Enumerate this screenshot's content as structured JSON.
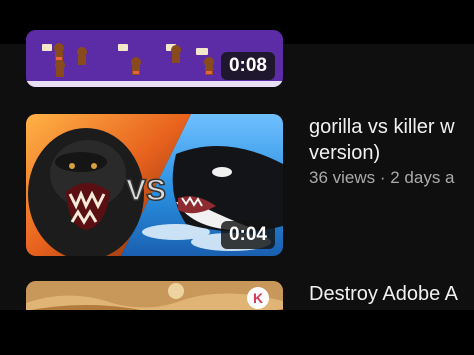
{
  "feed": {
    "videos": [
      {
        "title_line1": "",
        "title_line2": "",
        "meta": "",
        "duration": "0:08"
      },
      {
        "title_line1": "gorilla vs killer w",
        "title_line2": "version)",
        "meta": "36 views · 2 days a",
        "duration": "0:04",
        "thumb_text": "VS"
      },
      {
        "title_line1": "Destroy Adobe A",
        "meta": "",
        "badge": "K"
      }
    ]
  },
  "colors": {
    "background": "#0f0f0f",
    "title_text": "#f1f1f1",
    "meta_text": "#aaaaaa",
    "duration_bg": "#121212",
    "game_purple": "#5b2ca6"
  },
  "icons": {
    "third_thumb_badge": "kinemaster-logo-icon"
  }
}
